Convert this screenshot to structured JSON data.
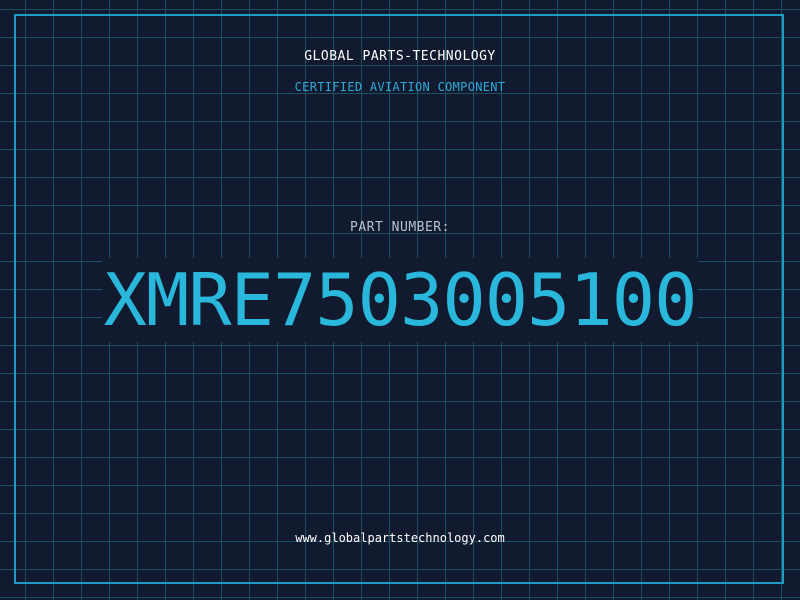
{
  "header": {
    "company_name": "GLOBAL PARTS-TECHNOLOGY",
    "tagline": "CERTIFIED AVIATION COMPONENT"
  },
  "part": {
    "label": "PART NUMBER:",
    "number": "XMRE7503005100"
  },
  "footer": {
    "website": "www.globalpartstechnology.com"
  },
  "colors": {
    "background": "#121a2f",
    "grid": "#1d4f63",
    "accent": "#29b8dc",
    "frame": "#1e9cc4"
  }
}
